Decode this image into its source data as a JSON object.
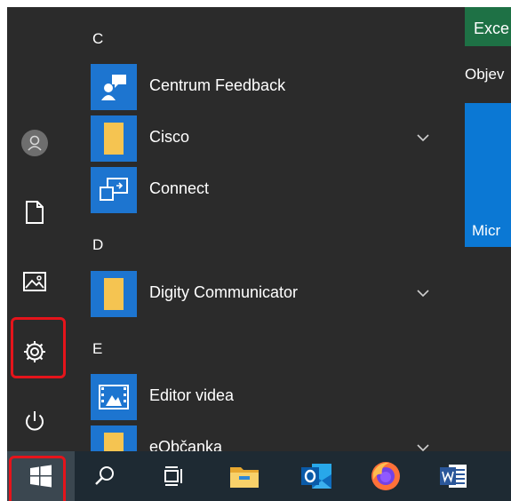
{
  "app_list": {
    "sections": [
      {
        "letter": "C",
        "apps": [
          {
            "name": "Centrum Feedback",
            "icon": "feedback-hub-icon",
            "expandable": false
          },
          {
            "name": "Cisco",
            "icon": "folder-icon",
            "expandable": true
          },
          {
            "name": "Connect",
            "icon": "connect-icon",
            "expandable": false
          }
        ]
      },
      {
        "letter": "D",
        "apps": [
          {
            "name": "Digity Communicator",
            "icon": "folder-icon",
            "expandable": true
          }
        ]
      },
      {
        "letter": "E",
        "apps": [
          {
            "name": "Editor videa",
            "icon": "video-editor-icon",
            "expandable": false
          },
          {
            "name": "eObčanka",
            "icon": "folder-icon",
            "expandable": true
          }
        ]
      }
    ]
  },
  "left_rail": {
    "items": [
      "user-avatar-icon",
      "document-icon",
      "pictures-icon",
      "settings-gear-icon",
      "power-icon"
    ],
    "highlighted": "settings-gear-icon"
  },
  "tiles": {
    "excel_label": "Exce",
    "section_label": "Objev",
    "ms_tile_label": "Micr"
  },
  "taskbar": {
    "items": [
      "windows-start-icon",
      "search-icon",
      "task-view-icon",
      "file-explorer-icon",
      "outlook-icon",
      "firefox-icon",
      "word-icon"
    ],
    "highlighted": "windows-start-icon"
  },
  "colors": {
    "menu_bg": "#2b2b2b",
    "taskbar_bg": "#1e2a33",
    "accent_blue": "#1d75d0",
    "highlight_red": "#e5141b",
    "excel_green": "#1e7145"
  }
}
